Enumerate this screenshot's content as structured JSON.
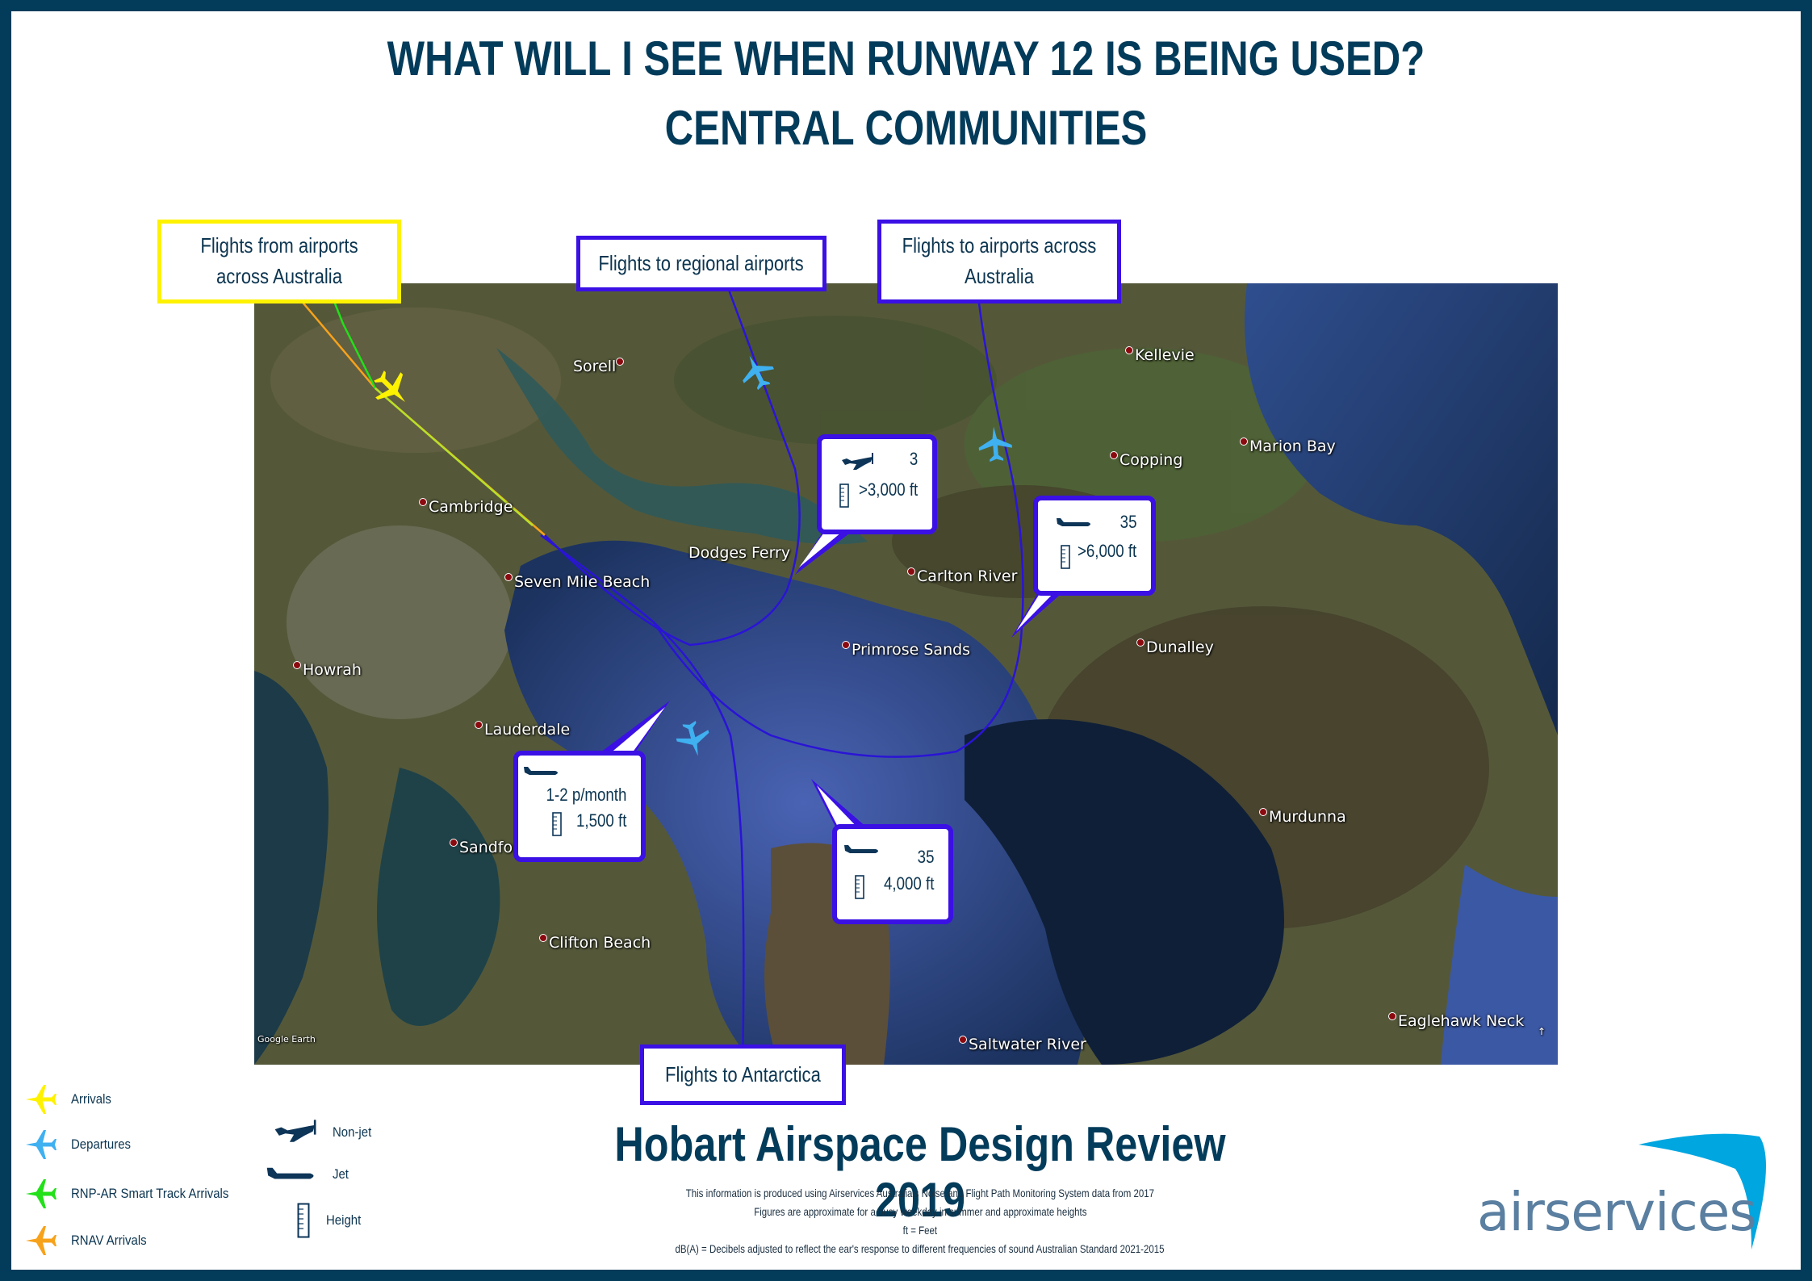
{
  "header": {
    "title_line1": "WHAT WILL I SEE WHEN RUNWAY 12 IS BEING USED?",
    "title_line2": "CENTRAL COMMUNITIES"
  },
  "route_labels": {
    "arrivals_from": "Flights from airports across Australia",
    "regional": "Flights to regional airports",
    "australia": "Flights to airports across Australia",
    "antarctica": "Flights to Antarctica"
  },
  "callouts": [
    {
      "aircraft": "non-jet",
      "count": "3",
      "height": ">3,000 ft"
    },
    {
      "aircraft": "jet",
      "count": "35",
      "height": ">6,000 ft"
    },
    {
      "aircraft": "jet",
      "count": "1-2 p/month",
      "height": "1,500 ft"
    },
    {
      "aircraft": "jet",
      "count": "35",
      "height": "4,000 ft"
    }
  ],
  "places": [
    {
      "name": "Sorell"
    },
    {
      "name": "Kellevie"
    },
    {
      "name": "Marion Bay"
    },
    {
      "name": "Copping"
    },
    {
      "name": "Cambridge"
    },
    {
      "name": "Dodges Ferry"
    },
    {
      "name": "Carlton River"
    },
    {
      "name": "Seven Mile Beach"
    },
    {
      "name": "Primrose Sands"
    },
    {
      "name": "Dunalley"
    },
    {
      "name": "Howrah"
    },
    {
      "name": "Lauderdale"
    },
    {
      "name": "Murdunna"
    },
    {
      "name": "Sandford"
    },
    {
      "name": "Clifton Beach"
    },
    {
      "name": "Eaglehawk Neck"
    },
    {
      "name": "Saltwater River"
    }
  ],
  "map_attribution": "Google Earth",
  "legend": {
    "routes": [
      {
        "label": "Arrivals",
        "color": "#fff200"
      },
      {
        "label": "Departures",
        "color": "#3fb0f0"
      },
      {
        "label": "RNP-AR Smart Track  Arrivals",
        "color": "#22e01a"
      },
      {
        "label": "RNAV Arrivals",
        "color": "#f7a21b"
      }
    ],
    "symbols": [
      {
        "label": "Non-jet"
      },
      {
        "label": "Jet"
      },
      {
        "label": "Height"
      }
    ]
  },
  "footer": {
    "title": "Hobart Airspace Design Review 2019",
    "notes": [
      "This information is produced using Airservices Australia's Noise and Flight Path Monitoring System data from 2017",
      "Figures  are approximate for a busy weekday in summer and approximate heights",
      "ft = Feet",
      "dB(A) = Decibels adjusted to reflect the ear's response to different frequencies of sound Australian Standard 2021-2015"
    ]
  },
  "logo": {
    "text": "airservices"
  },
  "colors": {
    "navy": "#033b5a",
    "route_line": "#2a14d6",
    "callout_border": "#3a10e5",
    "arrival_box": "#fff200",
    "departure": "#3fb0f0"
  }
}
